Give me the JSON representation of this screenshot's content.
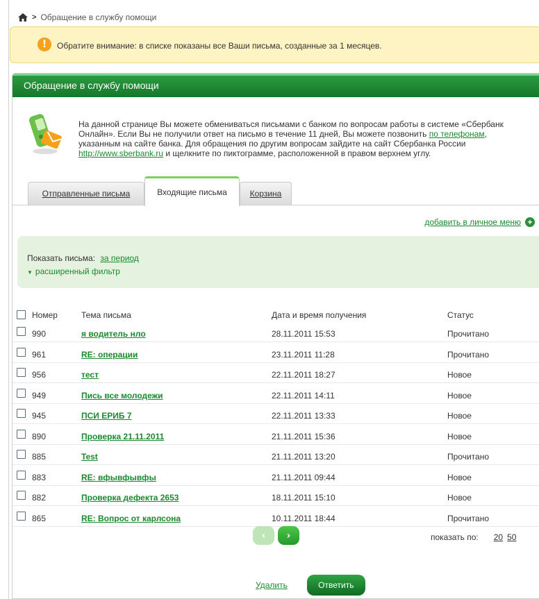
{
  "breadcrumb": {
    "home_icon": "home-icon",
    "current": "Обращение в службу помощи"
  },
  "notice": {
    "icon": "warning-icon",
    "text": "Обратите внимание: в списке показаны все Ваши письма, созданные за 1 месяцев."
  },
  "panel": {
    "title": "Обращение в службу помощи",
    "intro": {
      "part1": "На данной странице Вы можете обмениваться письмами с банком по вопросам работы в системе «Сбербанк Онлайн». Если Вы не получили ответ на письмо в течение 11 дней, Вы можете позвонить ",
      "phones_link": "по телефонам",
      "part2": ", указанным на сайте банка. Для обращения по другим вопросам зайдите на сайт Сбербанка России ",
      "site_link": "http://www.sberbank.ru",
      "part3": " и щелкните по пиктограмме, расположенной в правом верхнем углу."
    }
  },
  "tabs": [
    {
      "label": "Отправленные письма"
    },
    {
      "label": "Входящие письма"
    },
    {
      "label": "Корзина"
    }
  ],
  "add_menu": {
    "label": "добавить в личное меню",
    "icon": "plus-circle-icon"
  },
  "filter": {
    "show_label": "Показать письма:",
    "period_link": "за период",
    "advanced": "расширенный фильтр"
  },
  "table": {
    "headers": {
      "number": "Номер",
      "subject": "Тема письма",
      "date": "Дата и время получения",
      "status": "Статус"
    },
    "rows": [
      {
        "number": "990",
        "subject": "я водитель нло",
        "date": "28.11.2011 15:53",
        "status": "Прочитано"
      },
      {
        "number": "961",
        "subject": "RE: операции",
        "date": "23.11.2011 11:28",
        "status": "Прочитано"
      },
      {
        "number": "956",
        "subject": "тест",
        "date": "22.11.2011 18:27",
        "status": "Новое"
      },
      {
        "number": "949",
        "subject": "Пись все молодежи",
        "date": "22.11.2011 14:11",
        "status": "Новое"
      },
      {
        "number": "945",
        "subject": "ПСИ ЕРИБ 7",
        "date": "22.11.2011 13:33",
        "status": "Новое"
      },
      {
        "number": "890",
        "subject": "Проверка 21.11.2011",
        "date": "21.11.2011 15:36",
        "status": "Новое"
      },
      {
        "number": "885",
        "subject": "Test",
        "date": "21.11.2011 13:20",
        "status": "Прочитано"
      },
      {
        "number": "883",
        "subject": "RE: вфывфывфы",
        "date": "21.11.2011 09:44",
        "status": "Новое"
      },
      {
        "number": "882",
        "subject": "Проверка дефекта 2653",
        "date": "18.11.2011 15:10",
        "status": "Новое"
      },
      {
        "number": "865",
        "subject": "RE: Вопрос от карлсона",
        "date": "10.11.2011 18:44",
        "status": "Прочитано"
      }
    ]
  },
  "pagination": {
    "prev": "‹",
    "next": "›",
    "per_page_label": "показать по:",
    "options": [
      "20",
      "50"
    ]
  },
  "actions": {
    "delete": "Удалить",
    "reply": "Ответить"
  }
}
